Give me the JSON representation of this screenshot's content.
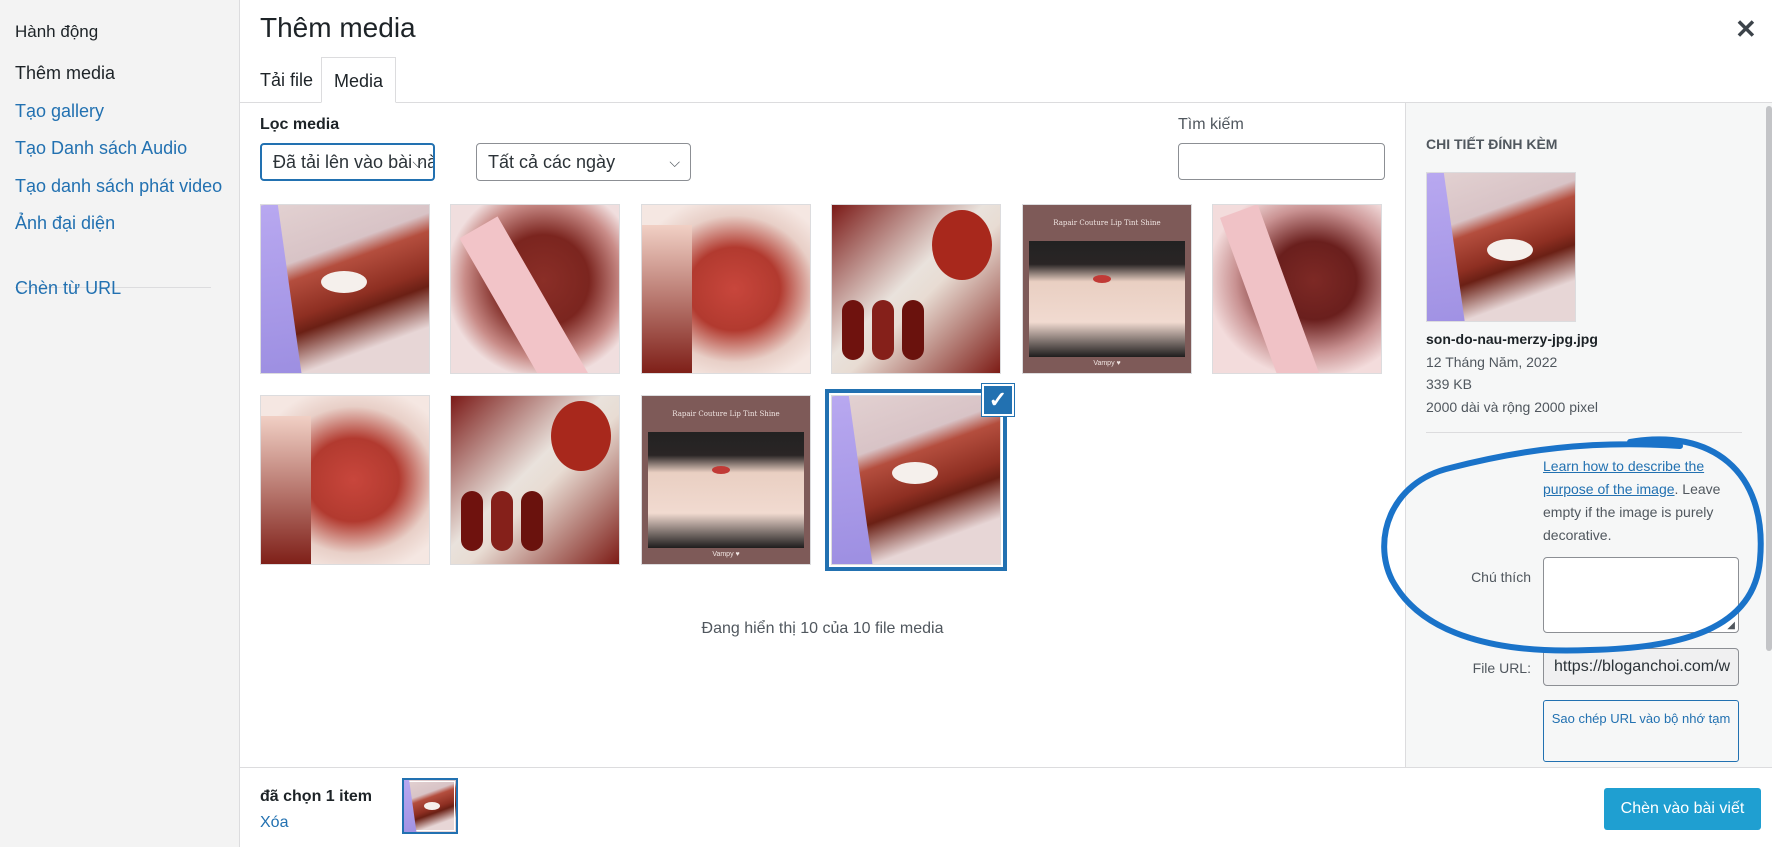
{
  "menu": {
    "heading": "Hành động",
    "items": [
      {
        "label": "Thêm media"
      },
      {
        "label": "Tạo gallery"
      },
      {
        "label": "Tạo Danh sách Audio"
      },
      {
        "label": "Tạo danh sách phát video"
      },
      {
        "label": "Ảnh đại diện"
      },
      {
        "label": "Chèn từ URL"
      }
    ]
  },
  "frame": {
    "title": "Thêm media",
    "close_glyph": "✕"
  },
  "tabs": [
    {
      "label": "Tải file"
    },
    {
      "label": "Media"
    }
  ],
  "toolbar": {
    "filter_label": "Lọc media",
    "type_select": "Đã tải lên vào bài này",
    "date_select": "Tất cả các ngày",
    "search_label": "Tìm kiếm",
    "chevron": "⌵"
  },
  "grid": {
    "items": [
      {
        "image": "lipstick-swatch-lavender-tube",
        "card_caption": "",
        "card_signature": ""
      },
      {
        "image": "lipstick-swatch-pink-label",
        "card_caption": "",
        "card_signature": ""
      },
      {
        "image": "lipstick-swatch-glossy-red",
        "card_caption": "",
        "card_signature": ""
      },
      {
        "image": "lipstick-collage",
        "card_caption": "",
        "card_signature": ""
      },
      {
        "image": "lip-tint-card",
        "card_caption": "Rapair Couture Lip Tint Shine",
        "card_signature": "Vampy ♥"
      },
      {
        "image": "lipstick-swatch-pink-label-2",
        "card_caption": "",
        "card_signature": ""
      },
      {
        "image": "lipstick-swatch-glossy-red-2",
        "card_caption": "",
        "card_signature": ""
      },
      {
        "image": "lipstick-collage-2",
        "card_caption": "",
        "card_signature": ""
      },
      {
        "image": "lip-tint-card-2",
        "card_caption": "Rapair Couture Lip Tint Shine",
        "card_signature": "Vampy ♥"
      },
      {
        "image": "lipstick-swatch-lavender-tube-selected",
        "card_caption": "",
        "card_signature": "",
        "selected": true
      }
    ],
    "status": "Đang hiển thị 10 của 10 file media",
    "check_glyph": "✓"
  },
  "details": {
    "title": "Chi tiết đính kèm",
    "filename": "son-do-nau-merzy-jpg.jpg",
    "date": "12 Tháng Năm, 2022",
    "size": "339 KB",
    "dimensions": "2000 dài và rộng 2000 pixel",
    "alt_help_link": "Learn how to describe the purpose of the image",
    "alt_help_text": ". Leave empty if the image is purely decorative.",
    "caption_label": "Chú thích",
    "caption_value": "",
    "url_label": "File URL:",
    "url_value": "https://bloganchoi.com/w",
    "copy_button": "Sao chép URL vào bộ nhớ tạm"
  },
  "footer": {
    "selected_count": "đã chọn 1 item",
    "clear_link": "Xóa",
    "insert_button": "Chèn vào bài viết"
  },
  "colors": {
    "accent": "#2271b1",
    "insert_button": "#1f9fd1",
    "annotation_ring": "#1a73c9"
  }
}
